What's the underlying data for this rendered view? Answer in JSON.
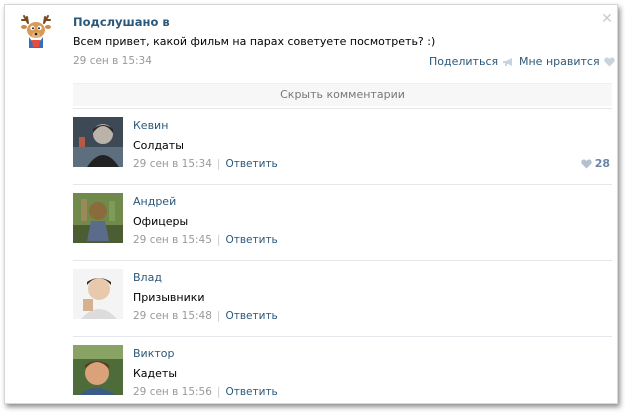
{
  "post": {
    "title": "Подслушано в",
    "text": "Всем привет, какой фильм на парах советуете посмотреть? :)",
    "time": "29 сен в 15:34",
    "share_label": "Поделиться",
    "like_label": "Мне нравится"
  },
  "hide_comments_label": "Скрыть комментарии",
  "comments": [
    {
      "name": "Кевин",
      "text": "Солдаты",
      "time": "29 сен в 15:34",
      "reply": "Ответить",
      "likes": "28"
    },
    {
      "name": "Андрей",
      "text": "Офицеры",
      "time": "29 сен в 15:45",
      "reply": "Ответить"
    },
    {
      "name": "Влад",
      "text": "Призывники",
      "time": "29 сен в 15:48",
      "reply": "Ответить"
    },
    {
      "name": "Виктор",
      "text": "Кадеты",
      "time": "29 сен в 15:56",
      "reply": "Ответить"
    }
  ],
  "colors": {
    "link": "#2b587a",
    "muted": "#999999",
    "likes": "#6a86a6"
  },
  "icons": [
    "deer-logo-icon",
    "close-icon",
    "megaphone-icon",
    "heart-icon"
  ]
}
